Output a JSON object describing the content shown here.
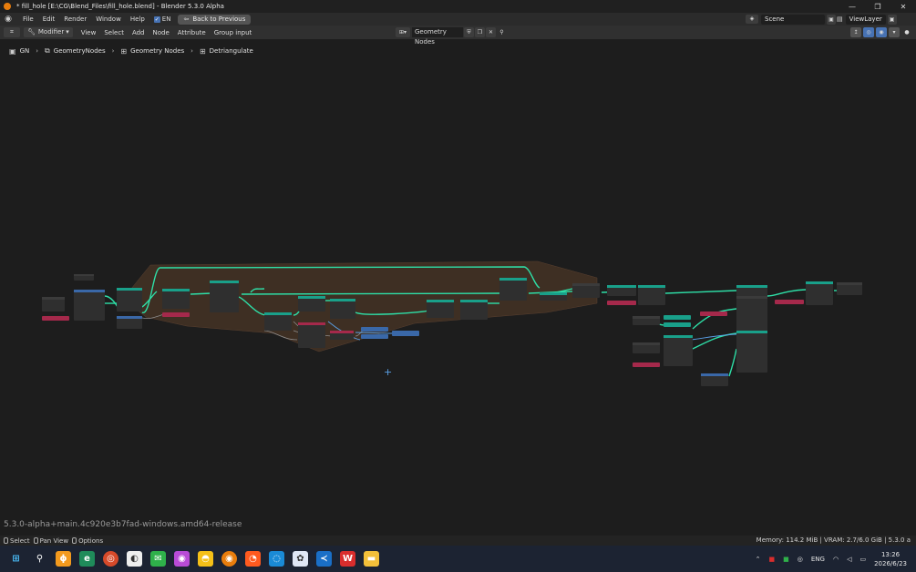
{
  "window": {
    "title": "* fill_hole [E:\\CG\\Blend_Files\\fill_hole.blend] - Blender 5.3.0 Alpha",
    "controls": [
      "—",
      "❐",
      "✕"
    ]
  },
  "menubar": {
    "items": [
      "File",
      "Edit",
      "Render",
      "Window",
      "Help"
    ],
    "en_label": "EN",
    "back_button": "Back to Previous",
    "scene": "Scene",
    "view_layer": "ViewLayer"
  },
  "editor_header": {
    "modifier": "Modifier",
    "menus": [
      "View",
      "Select",
      "Add",
      "Node",
      "Attribute",
      "Group input"
    ],
    "node_group": "Geometry Nodes"
  },
  "breadcrumb": [
    "GN",
    "GeometryNodes",
    "Geometry Nodes",
    "Detriangulate"
  ],
  "version_overlay": "5.3.0-alpha+main.4c920e3b7fad-windows.amd64-release",
  "statusbar": {
    "items": [
      "Select",
      "Pan View",
      "Options"
    ],
    "right": "Memory: 114.2 MiB | VRAM: 2.7/6.0 GiB | 5.3.0 a"
  },
  "taskbar": {
    "lang": "ENG",
    "time": "13:26",
    "date": "2026/6/23"
  },
  "colors": {
    "link_green": "#2ee0a8",
    "frame_brown": "#4a3526",
    "node_body": "#2f2f2f",
    "header_geometry": "#19a08a",
    "header_input": "#a5294b",
    "header_vector": "#3a68a8"
  }
}
